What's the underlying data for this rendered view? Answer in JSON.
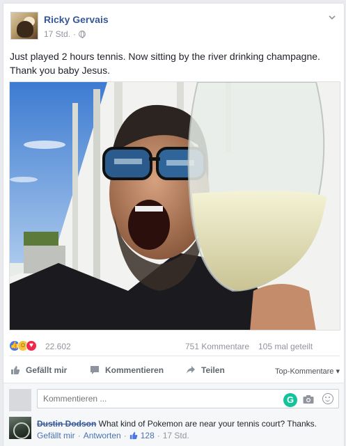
{
  "post": {
    "author": "Ricky Gervais",
    "time": "17 Std.",
    "separator": "·",
    "text": "Just played 2 hours tennis. Now sitting by the river drinking champagne. Thank you baby Jesus."
  },
  "counts": {
    "reactions": "22.602",
    "comments": "751 Kommentare",
    "shares": "105 mal geteilt"
  },
  "actions": {
    "like": "Gefällt mir",
    "comment": "Kommentieren",
    "share": "Teilen",
    "top_comments": "Top-Kommentare ▾"
  },
  "comment_box": {
    "placeholder": "Kommentieren ..."
  },
  "comments": [
    {
      "author": "Dustin Dodson",
      "text": "What kind of Pokemon are near your tennis court? Thanks.",
      "like": "Gefällt mir",
      "reply": "Antworten",
      "likes": "128",
      "time": "17 Std."
    }
  ],
  "colors": {
    "link": "#365899",
    "like_blue": "#4a76e8",
    "love_red": "#f0284a",
    "haha_yellow": "#f7c33d"
  }
}
